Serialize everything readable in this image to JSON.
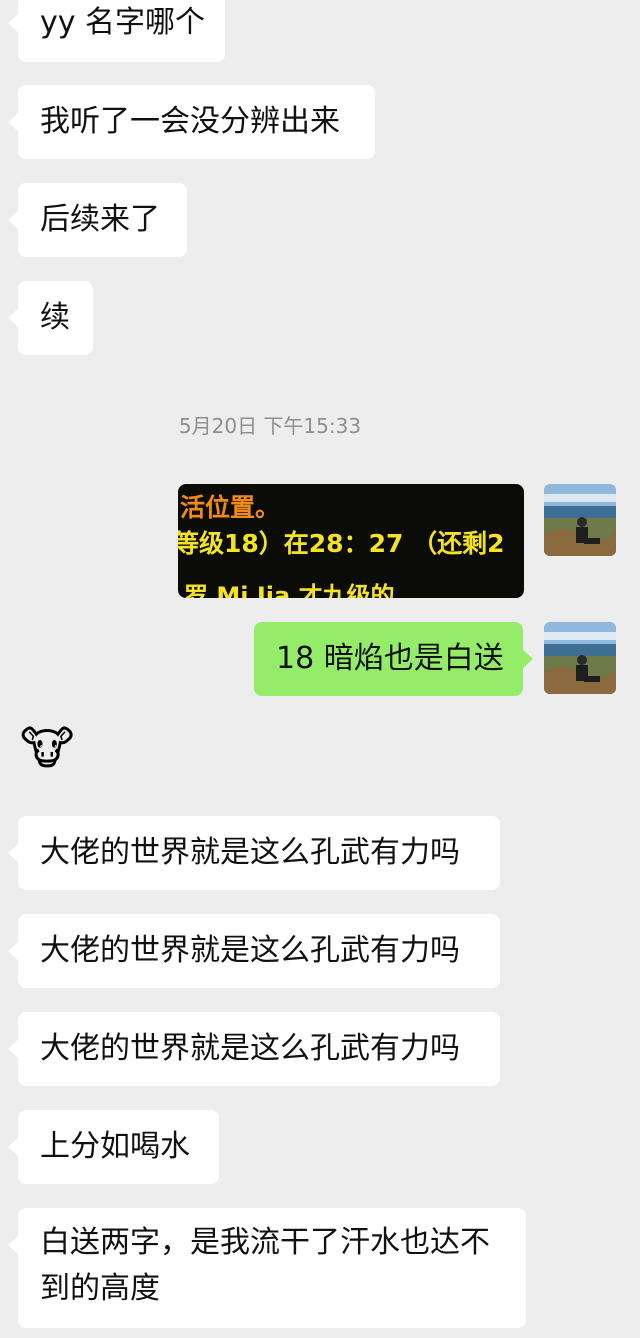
{
  "messages": {
    "m1": "yy 名字哪个",
    "m2": "我听了一会没分辨出来",
    "m3": "后续来了",
    "m4": "续",
    "timestamp": "5月20日 下午15:33",
    "image_lines": [
      "活位置。",
      "等级18）在28：27 （还剩2",
      "罗 Mi Jia 才九级的"
    ],
    "m5": "18 暗焰也是白送",
    "emoji": "🐮",
    "m6": "大佬的世界就是这么孔武有力吗",
    "m7": "大佬的世界就是这么孔武有力吗",
    "m8": "大佬的世界就是这么孔武有力吗",
    "m9": "上分如喝水",
    "m10": "白送两字，是我流干了汗水也达不到的高度"
  },
  "colors": {
    "background": "#ededed",
    "incoming_bubble": "#ffffff",
    "outgoing_bubble": "#95ec69",
    "image_text_orange": "#f28a12",
    "image_text_yellow": "#f3e321"
  }
}
